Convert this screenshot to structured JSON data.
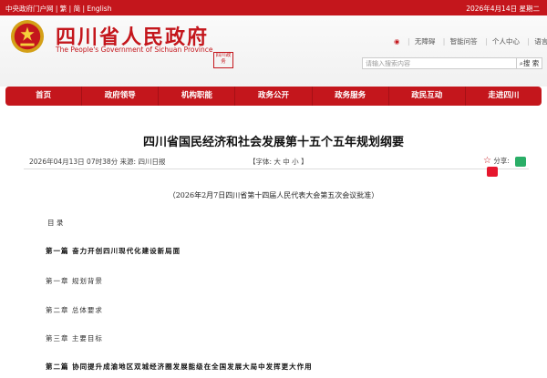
{
  "topbar": {
    "links": "中央政府门户网 | 繁 | 简 | English",
    "date": "2026年4月14日 星期二"
  },
  "header": {
    "title": "四川省人民政府",
    "subtitle": "The People's Government of Sichuan Province",
    "seal_text": "四川政务",
    "util": {
      "accessible": "无障碍",
      "smart": "智能问答",
      "personal": "个人中心",
      "lang": "语言版"
    },
    "search_placeholder": "请输入搜索内容",
    "search_button": "搜 索"
  },
  "nav": [
    "首页",
    "政府领导",
    "机构职能",
    "政务公开",
    "政务服务",
    "政民互动",
    "走进四川"
  ],
  "article": {
    "title": "四川省国民经济和社会发展第十五个五年规划纲要",
    "date_source": "2026年04月13日 07时38分  来源: 四川日报",
    "font_size": "【字体: 大  中  小 】",
    "share_label": "分享:",
    "approved": "（2026年2月7日四川省第十四届人民代表大会第五次会议批准）",
    "toc": "目 录",
    "items": [
      "第一篇  奋力开创四川现代化建设新局面",
      "第一章  规划背景",
      "第二章  总体要求",
      "第三章  主要目标",
      "第二篇  协同提升成渝地区双城经济圈发展能级在全国发展大局中发挥更大作用"
    ]
  },
  "colors": {
    "brand": "#c4161c"
  }
}
